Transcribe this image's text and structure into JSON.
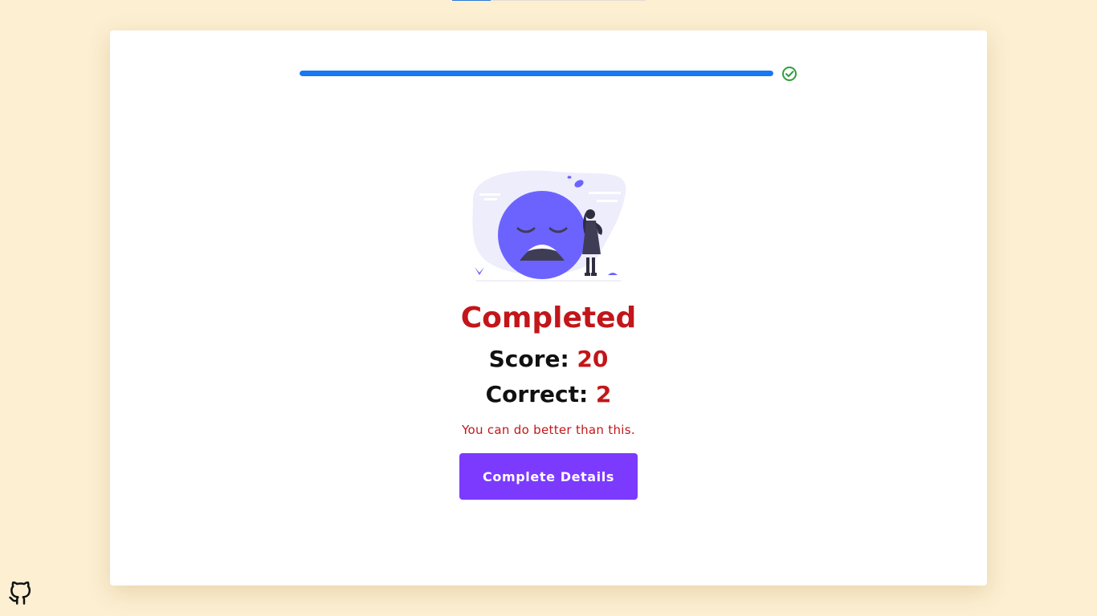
{
  "progress": {
    "percent": 100,
    "status_icon": "check-circle-icon",
    "color": "#1877f2",
    "check_color": "#2e9e3e"
  },
  "result": {
    "title": "Completed",
    "score_label": "Score:",
    "score_value": "20",
    "correct_label": "Correct:",
    "correct_value": "2",
    "message": "You can do better than this."
  },
  "actions": {
    "details_label": "Complete Details"
  },
  "illustration": {
    "icon": "sad-face-illustration"
  },
  "footer": {
    "icon": "github-icon"
  },
  "colors": {
    "accent": "#7c3aff",
    "result": "#c2161a",
    "background": "#fcefd2"
  }
}
